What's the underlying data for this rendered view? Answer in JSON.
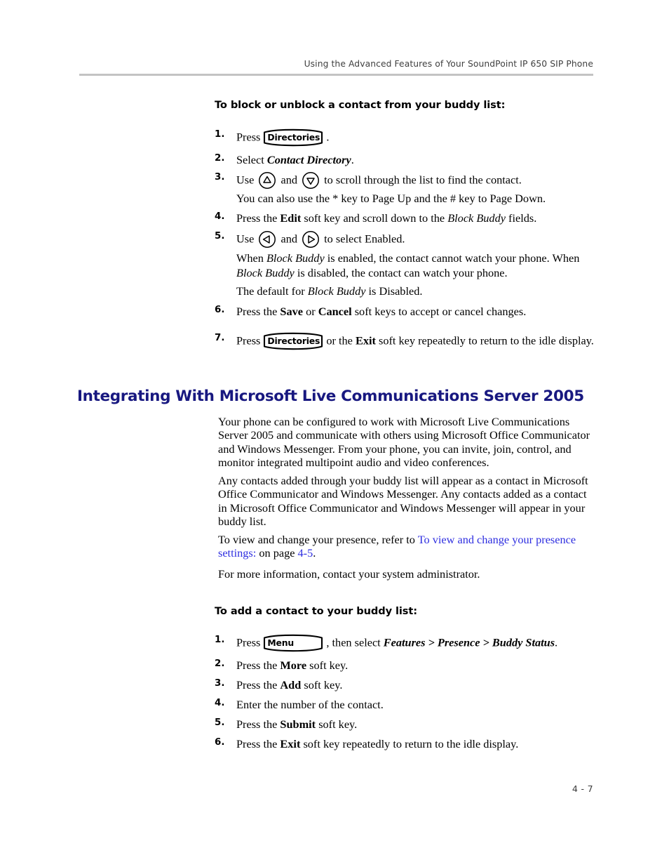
{
  "header": {
    "title": "Using the Advanced Features of Your SoundPoint IP 650 SIP Phone"
  },
  "footer": {
    "page_number": "4 - 7"
  },
  "colors": {
    "section_heading": "#181880",
    "hyperlink": "#2d2de0",
    "header_rule": "#c3c3c3",
    "header_text": "#3f3f3f"
  },
  "keys": {
    "directories": "Directories",
    "menu": "Menu"
  },
  "icons": {
    "arrow_up": "arrow-up-key-icon",
    "arrow_down": "arrow-down-key-icon",
    "arrow_left": "arrow-left-key-icon",
    "arrow_right": "arrow-right-key-icon"
  },
  "section_block": {
    "heading": "To block or unblock a contact from your buddy list:",
    "steps": [
      {
        "num": "1.",
        "pre": "Press",
        "key": "Directories",
        "post": "."
      },
      {
        "num": "2.",
        "pre": "Select",
        "emphasis": "Contact Directory",
        "post": "."
      },
      {
        "num": "3.",
        "pre": "Use",
        "mid": "and",
        "post": "to scroll through the list to find the contact.",
        "note": "You can also use the * key to Page Up and the # key to Page Down."
      },
      {
        "num": "4.",
        "pre": "Press the",
        "strong": "Edit",
        "mid": "soft key and scroll down to the",
        "emphasis": "Block Buddy",
        "post": "fields."
      },
      {
        "num": "5.",
        "pre": "Use",
        "mid": "and",
        "post": "to select Enabled.",
        "note1_a": "When",
        "note1_em1": "Block Buddy",
        "note1_b": "is enabled, the contact cannot watch your phone. When",
        "note1_em2": "Block Buddy",
        "note1_c": "is disabled, the contact can watch your phone.",
        "note2_a": "The default for",
        "note2_em": "Block Buddy",
        "note2_b": "is Disabled."
      },
      {
        "num": "6.",
        "pre": "Press the",
        "strong1": "Save",
        "mid": "or",
        "strong2": "Cancel",
        "post": "soft keys to accept or cancel changes."
      },
      {
        "num": "7.",
        "pre": "Press",
        "key": "Directories",
        "mid": "or the",
        "strong": "Exit",
        "post": "soft key repeatedly to return to the idle display."
      }
    ]
  },
  "section_lcs": {
    "heading": "Integrating With Microsoft Live Communications Server 2005",
    "paragraphs": [
      "Your phone can be configured to work with Microsoft Live Communications Server 2005 and communicate with others using Microsoft Office Communicator and Windows Messenger. From your phone, you can invite, join, control, and monitor integrated multipoint audio and video conferences.",
      "Any contacts added through your buddy list will appear as a contact in Microsoft Office Communicator and Windows Messenger. Any contacts added as a contact in Microsoft Office Communicator and Windows Messenger will appear in your buddy list."
    ],
    "xref": {
      "lead": "To view and change your presence, refer to",
      "link_text": "To view and change your presence settings:",
      "middle": "on page",
      "page_link": "4-5",
      "end": "."
    },
    "more_info": "For more information, contact your system administrator."
  },
  "section_add": {
    "heading": "To add a contact to your buddy list:",
    "steps": [
      {
        "num": "1.",
        "pre": "Press",
        "key": "Menu",
        "mid": ", then select",
        "emphasis": "Features > Presence > Buddy Status",
        "post": "."
      },
      {
        "num": "2.",
        "pre": "Press the",
        "strong": "More",
        "post": "soft key."
      },
      {
        "num": "3.",
        "pre": "Press the",
        "strong": "Add",
        "post": "soft key."
      },
      {
        "num": "4.",
        "text": "Enter the number of the contact."
      },
      {
        "num": "5.",
        "pre": "Press the",
        "strong": "Submit",
        "post": "soft key."
      },
      {
        "num": "6.",
        "pre": "Press the",
        "strong": "Exit",
        "post": "soft key repeatedly to return to the idle display."
      }
    ]
  }
}
